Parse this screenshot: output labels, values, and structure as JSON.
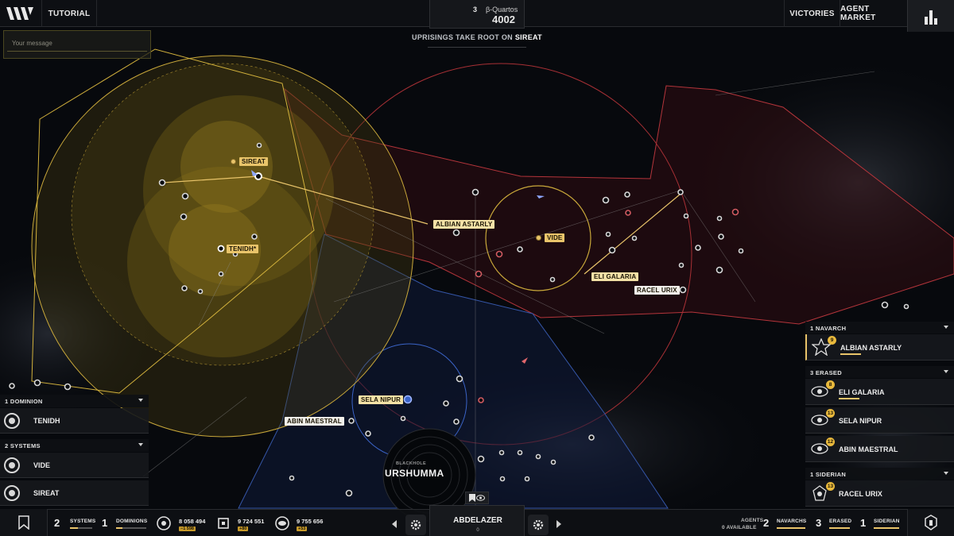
{
  "topbar": {
    "tutorial_label": "TUTORIAL",
    "victories_label": "VICTORIES",
    "agent_market_label": "AGENT MARKET",
    "turn_number": "3",
    "season": "β-Quartos",
    "year": "4002"
  },
  "event": {
    "prefix": "UPRISINGS TAKE ROOT ON",
    "system": "SIREAT"
  },
  "chat": {
    "placeholder": "Your message"
  },
  "map_labels": {
    "sireat": "SIREAT",
    "tenidh": "TENIDH*",
    "albian": "ALBIAN ASTARLY",
    "vide": "VIDE",
    "eli": "ELI GALARIA",
    "racel": "RACEL URIX",
    "sela": "SELA NIPUR",
    "abin": "ABIN MAESTRAL"
  },
  "blackhole": {
    "small": "BLACKHOLE",
    "name": "URSHUMMA"
  },
  "left_panel": {
    "dominion_header": "1 DOMINION",
    "dominions": [
      {
        "name": "TENIDH"
      }
    ],
    "systems_header": "2 SYSTEMS",
    "systems": [
      {
        "name": "VIDE"
      },
      {
        "name": "SIREAT"
      }
    ]
  },
  "right_panel": {
    "navarch_header": "1 NAVARCH",
    "navarchs": [
      {
        "name": "ALBIAN ASTARLY",
        "level": "9"
      }
    ],
    "erased_header": "3 ERASED",
    "erased": [
      {
        "name": "ELI GALARIA",
        "level": "8"
      },
      {
        "name": "SELA NIPUR",
        "level": "13"
      },
      {
        "name": "ABIN MAESTRAL",
        "level": "12"
      }
    ],
    "siderian_header": "1 SIDERIAN",
    "siderians": [
      {
        "name": "RACEL URIX",
        "level": "13"
      }
    ]
  },
  "bottombar": {
    "systems_count": "2",
    "systems_label": "SYSTEMS",
    "dominions_count": "1",
    "dominions_label": "DOMINIONS",
    "credits": "8 058 494",
    "credits_delta": "−1 598",
    "technology": "9 724 551",
    "technology_delta": "+80",
    "ideology": "9 755 656",
    "ideology_delta": "+53",
    "player_name": "ABDELAZER",
    "player_count": "0",
    "agents_label": "AGENTS",
    "agents_available": "0 AVAILABLE",
    "navarchs_count": "2",
    "navarchs_label": "NAVARCHS",
    "erased_count": "3",
    "erased_label": "ERASED",
    "siderian_count": "1",
    "siderian_label": "SIDERIAN"
  },
  "colors": {
    "gold": "#e9c46a",
    "red_faction": "#c0383c",
    "blue_faction": "#3b64c8",
    "panel_bg": "#16181c"
  }
}
